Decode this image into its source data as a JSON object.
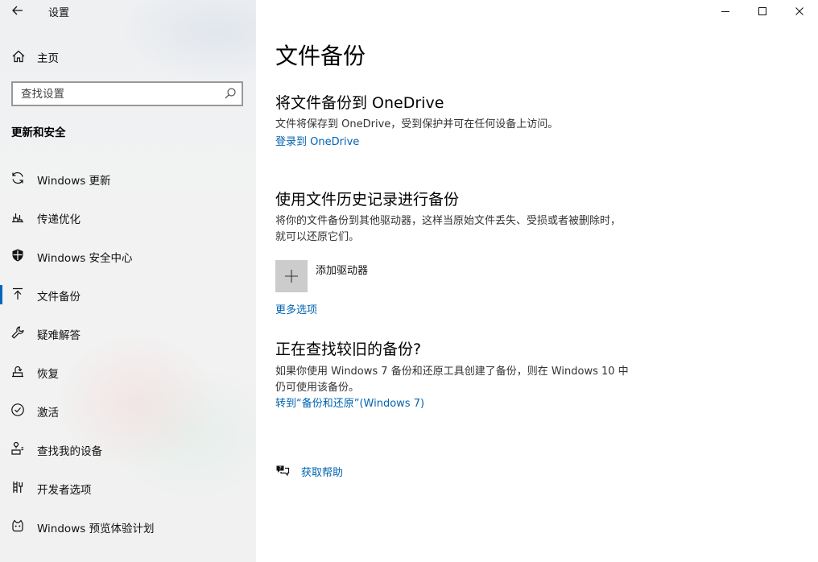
{
  "app": {
    "title": "设置"
  },
  "sidebar": {
    "home_label": "主页",
    "search_placeholder": "查找设置",
    "section_title": "更新和安全",
    "items": [
      {
        "label": "Windows 更新",
        "icon": "sync-icon",
        "selected": false
      },
      {
        "label": "传递优化",
        "icon": "delivery-optimization-icon",
        "selected": false
      },
      {
        "label": "Windows 安全中心",
        "icon": "shield-icon",
        "selected": false
      },
      {
        "label": "文件备份",
        "icon": "backup-arrow-icon",
        "selected": true
      },
      {
        "label": "疑难解答",
        "icon": "wrench-icon",
        "selected": false
      },
      {
        "label": "恢复",
        "icon": "recovery-icon",
        "selected": false
      },
      {
        "label": "激活",
        "icon": "check-circle-icon",
        "selected": false
      },
      {
        "label": "查找我的设备",
        "icon": "find-device-icon",
        "selected": false
      },
      {
        "label": "开发者选项",
        "icon": "developer-icon",
        "selected": false
      },
      {
        "label": "Windows 预览体验计划",
        "icon": "insider-icon",
        "selected": false
      }
    ]
  },
  "main": {
    "page_title": "文件备份",
    "onedrive": {
      "heading": "将文件备份到 OneDrive",
      "description": "文件将保存到 OneDrive，受到保护并可在任何设备上访问。",
      "link": "登录到 OneDrive"
    },
    "file_history": {
      "heading": "使用文件历史记录进行备份",
      "description": "将你的文件备份到其他驱动器，这样当原始文件丢失、受损或者被删除时，就可以还原它们。",
      "add_drive_label": "添加驱动器",
      "more_options_link": "更多选项"
    },
    "older_backup": {
      "heading": "正在查找较旧的备份?",
      "description": "如果你使用 Windows 7 备份和还原工具创建了备份，则在 Windows 10 中仍可使用该备份。",
      "link": "转到“备份和还原”(Windows 7)"
    },
    "help_link": "获取帮助"
  },
  "colors": {
    "accent": "#0063b1",
    "selection_bar": "#0067c0",
    "add_tile": "#cccccc"
  }
}
